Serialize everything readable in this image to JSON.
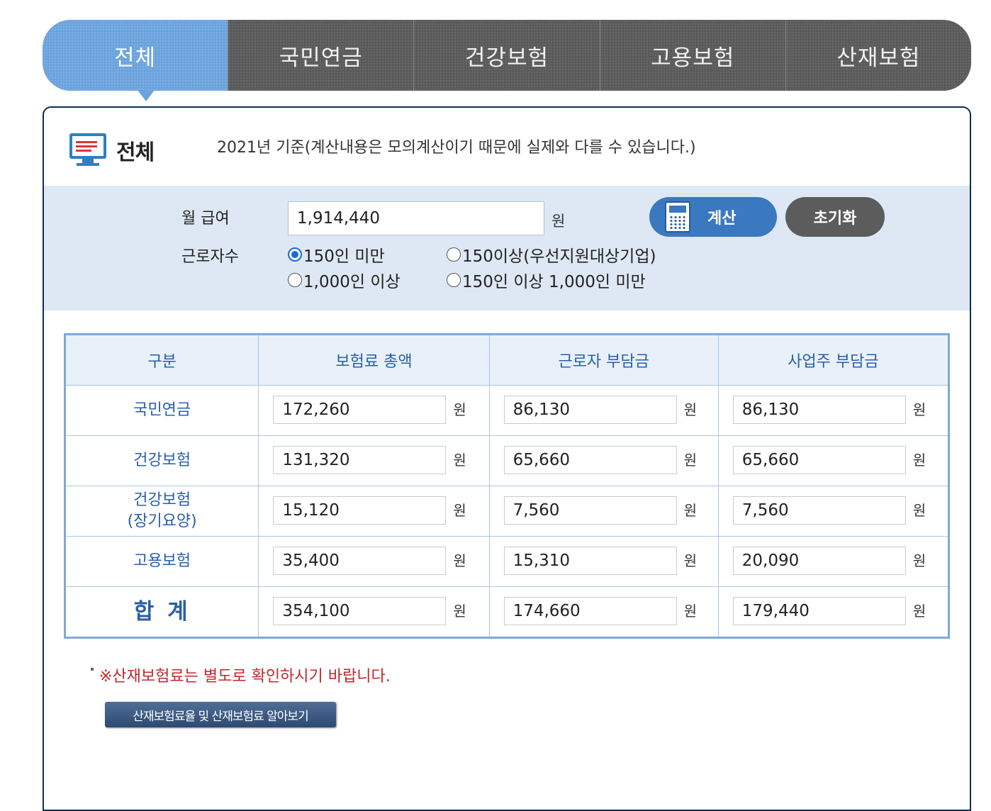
{
  "tabs": [
    {
      "label": "전체",
      "active": true
    },
    {
      "label": "국민연금",
      "active": false
    },
    {
      "label": "건강보험",
      "active": false
    },
    {
      "label": "고용보험",
      "active": false
    },
    {
      "label": "산재보험",
      "active": false
    }
  ],
  "panel": {
    "title": "전체",
    "icon": "monitor-icon",
    "note": "2021년 기준(계산내용은 모의계산이기 때문에 실제와 다를 수 있습니다.)"
  },
  "form": {
    "salary_label": "월 급여",
    "salary_value": "1,914,440",
    "salary_unit": "원",
    "workers_label": "근로자수",
    "calc_button": "계산",
    "reset_button": "초기화",
    "options": [
      {
        "label": "150인 미만",
        "checked": true
      },
      {
        "label": "150이상(우선지원대상기업)",
        "checked": false
      },
      {
        "label": "1,000인 이상",
        "checked": false
      },
      {
        "label": "150인 이상 1,000인 미만",
        "checked": false
      }
    ]
  },
  "table": {
    "headers": [
      "구분",
      "보험료 총액",
      "근로자 부담금",
      "사업주 부담금"
    ],
    "unit": "원",
    "rows": [
      {
        "label": "국민연금",
        "values": [
          "172,260",
          "86,130",
          "86,130"
        ]
      },
      {
        "label": "건강보험",
        "values": [
          "131,320",
          "65,660",
          "65,660"
        ]
      },
      {
        "label": "건강보험\n(장기요양)",
        "values": [
          "15,120",
          "7,560",
          "7,560"
        ]
      },
      {
        "label": "고용보험",
        "values": [
          "35,400",
          "15,310",
          "20,090"
        ]
      },
      {
        "label": "합 계",
        "values": [
          "354,100",
          "174,660",
          "179,440"
        ]
      }
    ]
  },
  "notice": "※산재보험료는 별도로 확인하시기 바랍니다.",
  "link_button": "산재보험료율 및 산재보험료 알아보기",
  "colors": {
    "active_tab": "#6aa3dd",
    "inactive_tab": "#5a5a5a",
    "form_bg": "#dde8f4",
    "table_text": "#2a5fa8",
    "notice": "#c0272d"
  }
}
